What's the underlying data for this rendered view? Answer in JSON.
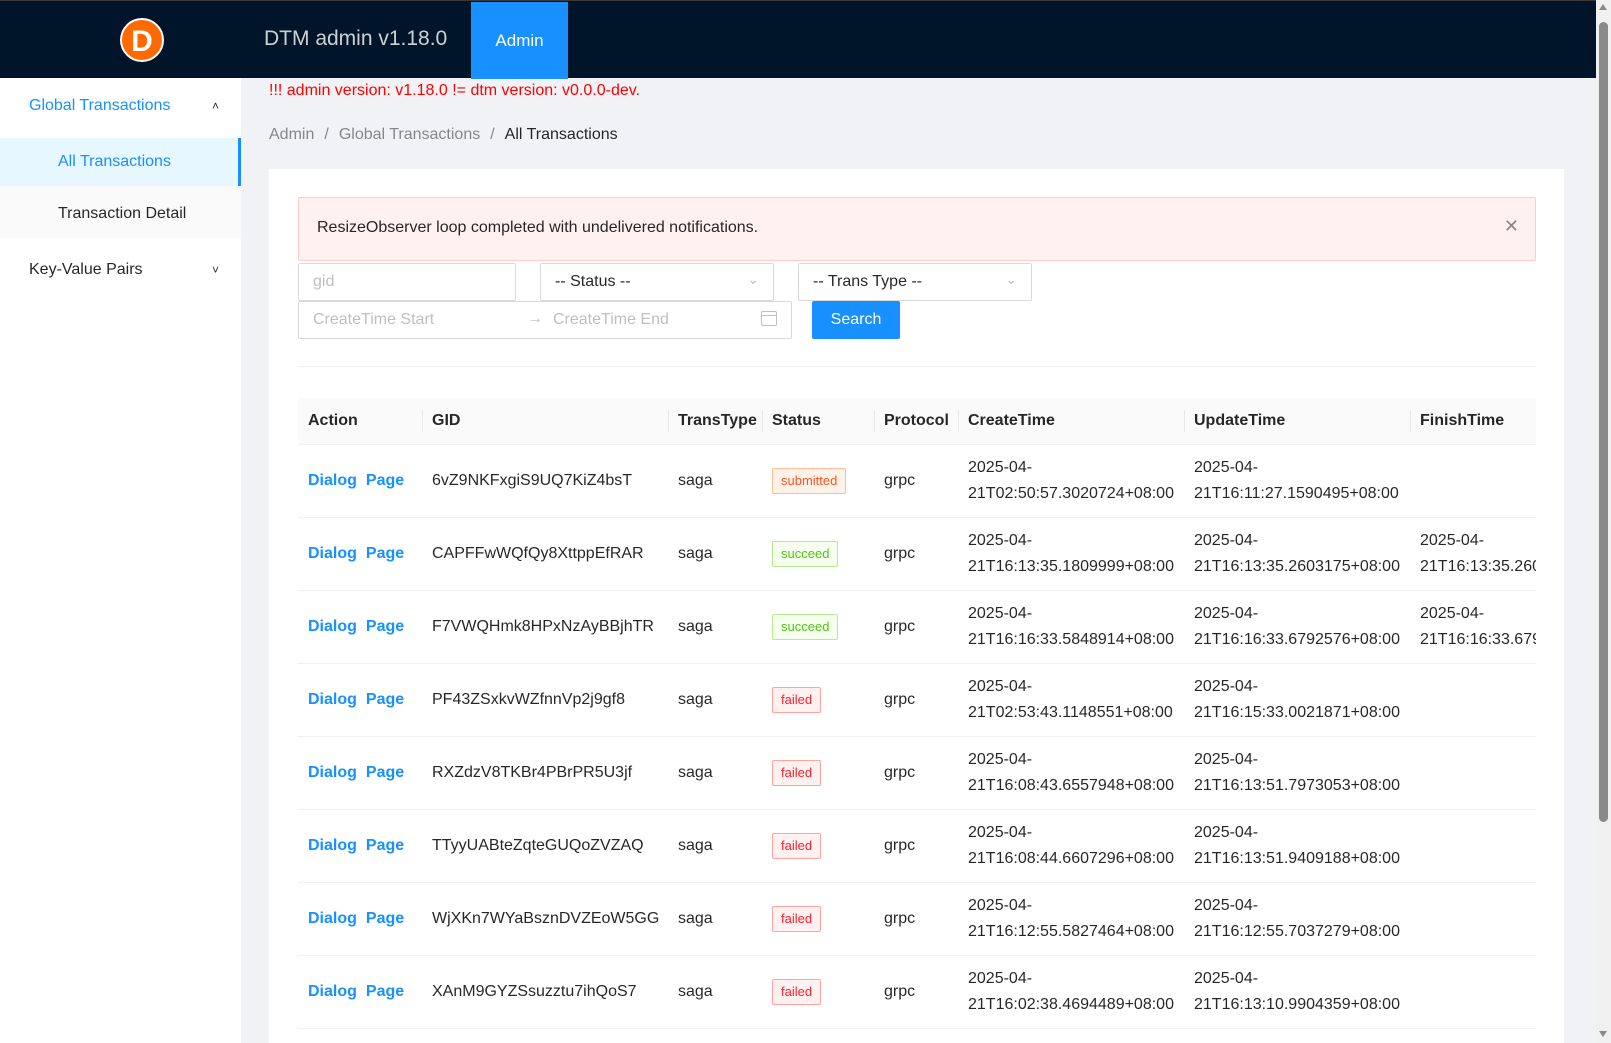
{
  "header": {
    "logo_letter": "D",
    "app_title": "DTM admin v1.18.0",
    "nav_tab": "Admin"
  },
  "sidebar": {
    "global": {
      "label": "Global Transactions",
      "expanded": true,
      "items": [
        {
          "label": "All Transactions",
          "active": true
        },
        {
          "label": "Transaction Detail",
          "active": false
        }
      ]
    },
    "kv": {
      "label": "Key-Value Pairs",
      "expanded": false
    }
  },
  "version_warning": "!!! admin version: v1.18.0 != dtm version: v0.0.0-dev.",
  "breadcrumb": {
    "items": [
      "Admin",
      "Global Transactions",
      "All Transactions"
    ],
    "separator": "/"
  },
  "alert": {
    "message": "ResizeObserver loop completed with undelivered notifications."
  },
  "filters": {
    "gid_placeholder": "gid",
    "status_placeholder": "-- Status --",
    "transtype_placeholder": "-- Trans Type --",
    "create_start_placeholder": "CreateTime Start",
    "create_end_placeholder": "CreateTime End",
    "search_label": "Search"
  },
  "table": {
    "columns": [
      "Action",
      "GID",
      "TransType",
      "Status",
      "Protocol",
      "CreateTime",
      "UpdateTime",
      "FinishTime"
    ],
    "action_labels": {
      "dialog": "Dialog",
      "page": "Page"
    },
    "rows": [
      {
        "gid": "6vZ9NKFxgiS9UQ7KiZ4bsT",
        "trans_type": "saga",
        "status": "submitted",
        "protocol": "grpc",
        "create_date": "2025-04-",
        "create_time": "21T02:50:57.3020724+08:00",
        "update_date": "2025-04-",
        "update_time": "21T16:11:27.1590495+08:00",
        "finish_date": "",
        "finish_time": ""
      },
      {
        "gid": "CAPFFwWQfQy8XttppEfRAR",
        "trans_type": "saga",
        "status": "succeed",
        "protocol": "grpc",
        "create_date": "2025-04-",
        "create_time": "21T16:13:35.1809999+08:00",
        "update_date": "2025-04-",
        "update_time": "21T16:13:35.2603175+08:00",
        "finish_date": "2025-04-",
        "finish_time": "21T16:13:35.260"
      },
      {
        "gid": "F7VWQHmk8HPxNzAyBBjhTR",
        "trans_type": "saga",
        "status": "succeed",
        "protocol": "grpc",
        "create_date": "2025-04-",
        "create_time": "21T16:16:33.5848914+08:00",
        "update_date": "2025-04-",
        "update_time": "21T16:16:33.6792576+08:00",
        "finish_date": "2025-04-",
        "finish_time": "21T16:16:33.679"
      },
      {
        "gid": "PF43ZSxkvWZfnnVp2j9gf8",
        "trans_type": "saga",
        "status": "failed",
        "protocol": "grpc",
        "create_date": "2025-04-",
        "create_time": "21T02:53:43.1148551+08:00",
        "update_date": "2025-04-",
        "update_time": "21T16:15:33.0021871+08:00",
        "finish_date": "",
        "finish_time": ""
      },
      {
        "gid": "RXZdzV8TKBr4PBrPR5U3jf",
        "trans_type": "saga",
        "status": "failed",
        "protocol": "grpc",
        "create_date": "2025-04-",
        "create_time": "21T16:08:43.6557948+08:00",
        "update_date": "2025-04-",
        "update_time": "21T16:13:51.7973053+08:00",
        "finish_date": "",
        "finish_time": ""
      },
      {
        "gid": "TTyyUABteZqteGUQoZVZAQ",
        "trans_type": "saga",
        "status": "failed",
        "protocol": "grpc",
        "create_date": "2025-04-",
        "create_time": "21T16:08:44.6607296+08:00",
        "update_date": "2025-04-",
        "update_time": "21T16:13:51.9409188+08:00",
        "finish_date": "",
        "finish_time": ""
      },
      {
        "gid": "WjXKn7WYaBsznDVZEoW5GG",
        "trans_type": "saga",
        "status": "failed",
        "protocol": "grpc",
        "create_date": "2025-04-",
        "create_time": "21T16:12:55.5827464+08:00",
        "update_date": "2025-04-",
        "update_time": "21T16:12:55.7037279+08:00",
        "finish_date": "",
        "finish_time": ""
      },
      {
        "gid": "XAnM9GYZSsuzztu7ihQoS7",
        "trans_type": "saga",
        "status": "failed",
        "protocol": "grpc",
        "create_date": "2025-04-",
        "create_time": "21T16:02:38.4694489+08:00",
        "update_date": "2025-04-",
        "update_time": "21T16:13:10.9904359+08:00",
        "finish_date": "",
        "finish_time": ""
      }
    ]
  },
  "colors": {
    "header_bg": "#001529",
    "primary": "#1890ff",
    "logo": "#ff6a00",
    "warning_text": "#ff0000"
  }
}
